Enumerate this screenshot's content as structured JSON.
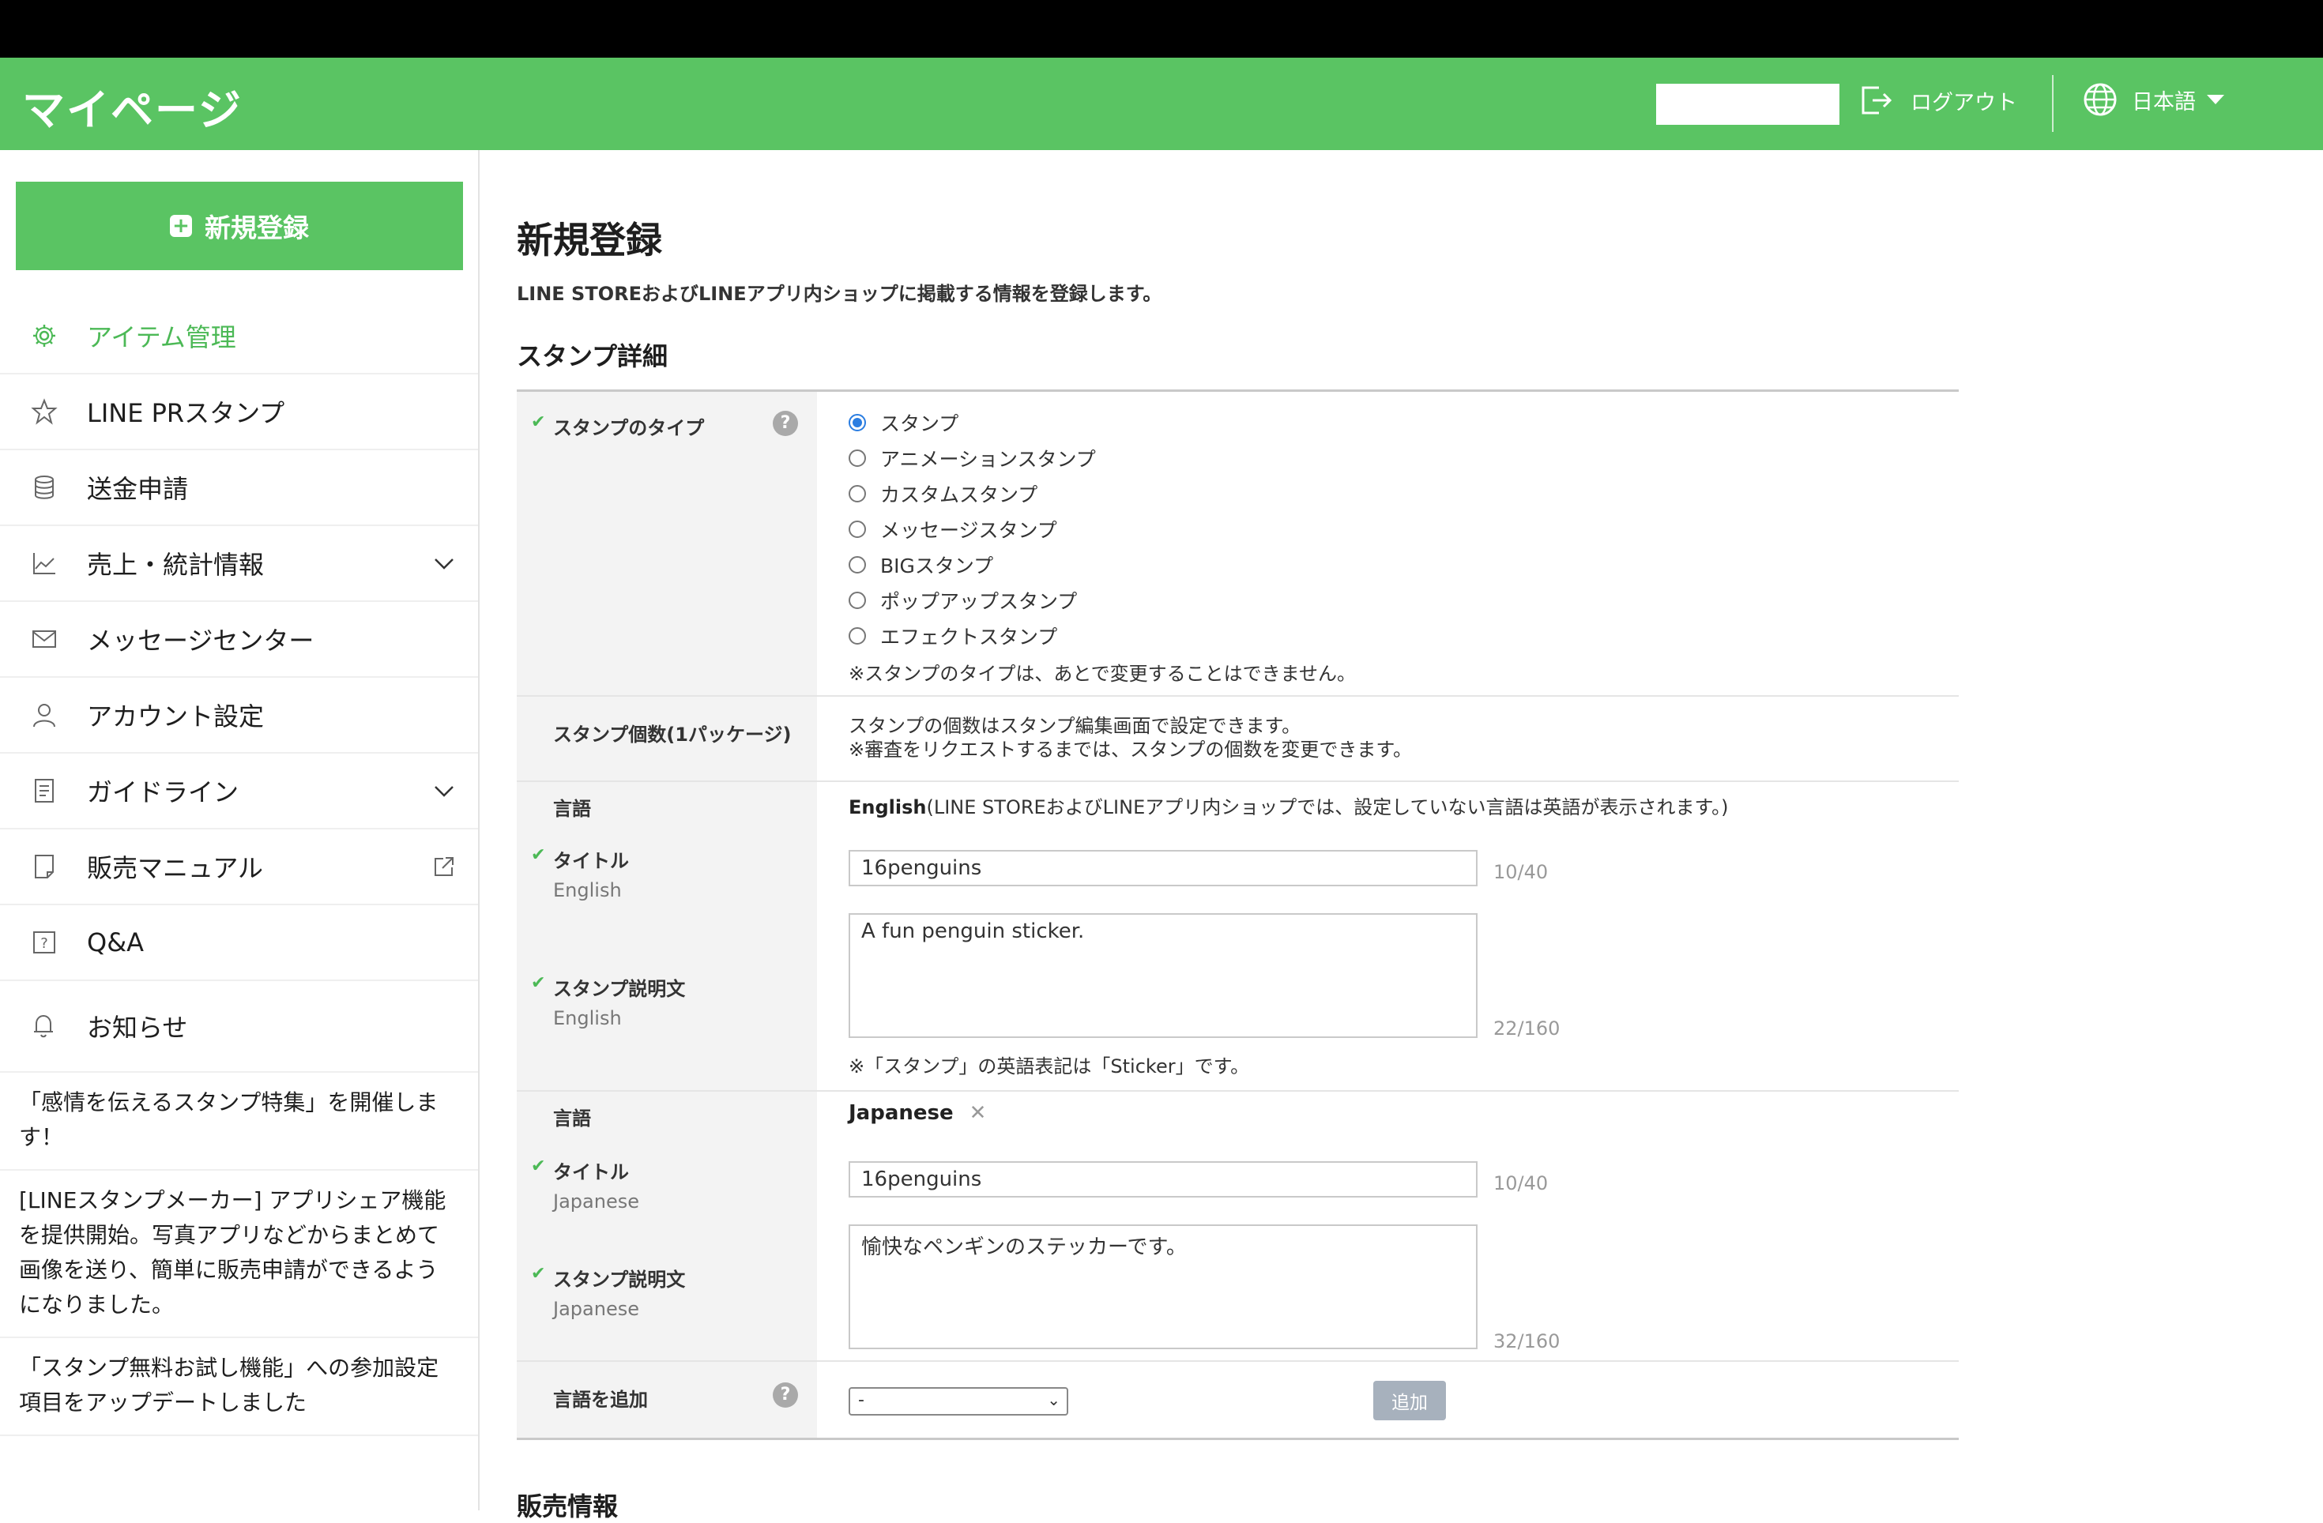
{
  "header": {
    "title": "マイページ",
    "logout_label": "ログアウト",
    "language_label": "日本語"
  },
  "sidebar": {
    "new_button_label": "新規登録",
    "items": [
      {
        "label": "アイテム管理",
        "icon": "gear-icon"
      },
      {
        "label": "LINE PRスタンプ",
        "icon": "star-icon"
      },
      {
        "label": "送金申請",
        "icon": "database-icon"
      },
      {
        "label": "売上・統計情報",
        "icon": "chart-icon"
      },
      {
        "label": "メッセージセンター",
        "icon": "mail-icon"
      },
      {
        "label": "アカウント設定",
        "icon": "user-icon"
      },
      {
        "label": "ガイドライン",
        "icon": "document-icon"
      },
      {
        "label": "販売マニュアル",
        "icon": "note-icon"
      },
      {
        "label": "Q&A",
        "icon": "question-icon"
      }
    ],
    "notices_title": "お知らせ",
    "notices": [
      "「感情を伝えるスタンプ特集」を開催します！",
      "[LINEスタンプメーカー] アプリシェア機能を提供開始。写真アプリなどからまとめて画像を送り、簡単に販売申請ができるようになりました。",
      "「スタンプ無料お試し機能」への参加設定項目をアップデートしました"
    ]
  },
  "main": {
    "page_title": "新規登録",
    "page_desc": "LINE STOREおよびLINEアプリ内ショップに掲載する情報を登録します。",
    "section_title": "スタンプ詳細",
    "type_label": "スタンプのタイプ",
    "type_options": [
      "スタンプ",
      "アニメーションスタンプ",
      "カスタムスタンプ",
      "メッセージスタンプ",
      "BIGスタンプ",
      "ポップアップスタンプ",
      "エフェクトスタンプ"
    ],
    "type_selected": "スタンプ",
    "type_note": "※スタンプのタイプは、あとで変更することはできません。",
    "count_label": "スタンプ個数(1パッケージ)",
    "count_note1": "スタンプの個数はスタンプ編集画面で設定できます。",
    "count_note2": "※審査をリクエストするまでは、スタンプの個数を変更できます。",
    "lang_label": "言語",
    "en_lang_name": "English",
    "en_lang_note": "(LINE STOREおよびLINEアプリ内ショップでは、設定していない言語は英語が表示されます。)",
    "title_label": "タイトル",
    "desc_label": "スタンプ説明文",
    "en_sub": "English",
    "en_title_value": "16penguins",
    "en_title_count": "10/40",
    "en_desc_value": "A fun penguin sticker.",
    "en_desc_count": "22/160",
    "en_note": "※「スタンプ」の英語表記は「Sticker」です。",
    "ja_lang_name": "Japanese",
    "ja_remove": "✕",
    "ja_sub": "Japanese",
    "ja_title_value": "16penguins",
    "ja_title_count": "10/40",
    "ja_desc_value": "愉快なペンギンのステッカーです。",
    "ja_desc_count": "32/160",
    "add_lang_label": "言語を追加",
    "add_lang_select": "-",
    "add_button": "追加",
    "next_section": "販売情報"
  },
  "colors": {
    "brand_green": "#5ac463",
    "active_green": "#4cb956",
    "radio_blue": "#2a7de1"
  }
}
